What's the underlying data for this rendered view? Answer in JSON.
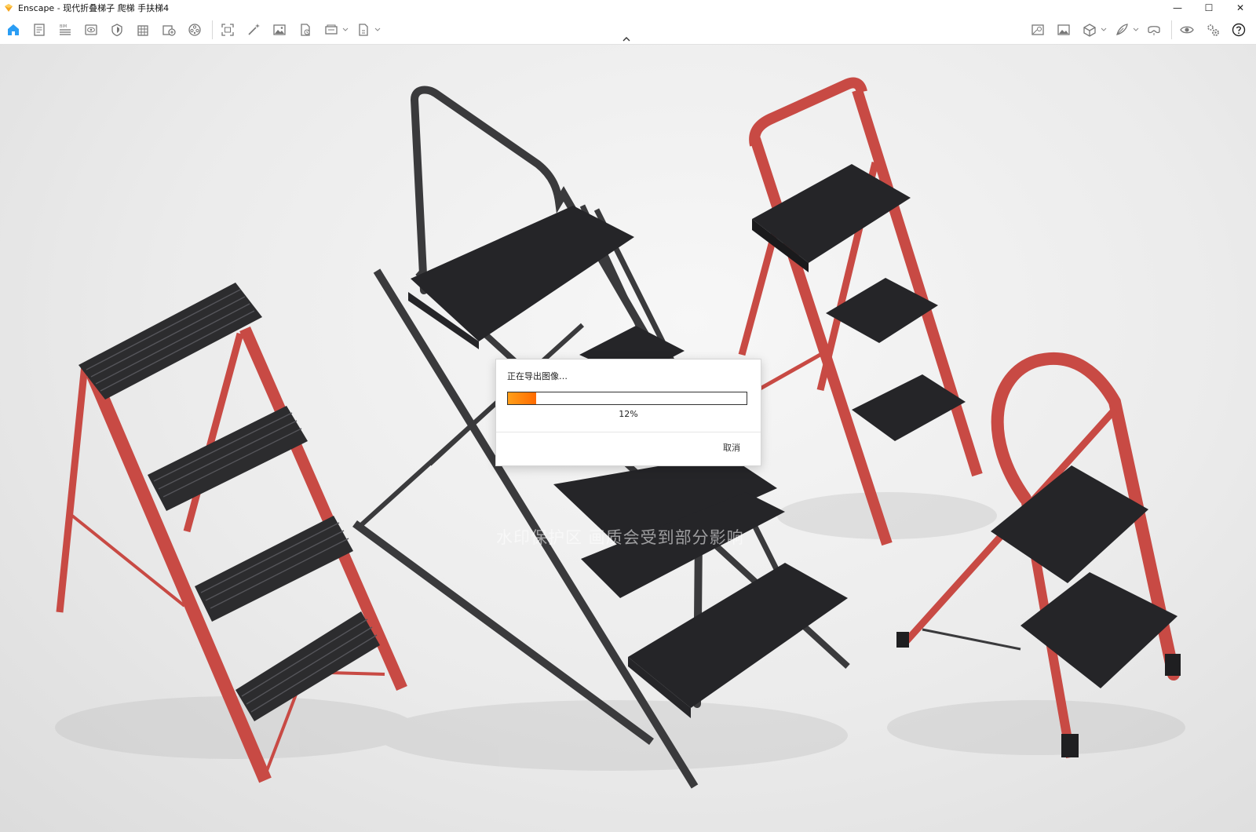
{
  "window": {
    "title": "Enscape - 现代折叠梯子 爬梯 手扶梯4",
    "minimize_glyph": "—",
    "maximize_glyph": "☐",
    "close_glyph": "✕"
  },
  "colors": {
    "accent": "#2a9df4",
    "progress": "#ff7a00",
    "ladder_red": "#c84a44",
    "ladder_black": "#2a2a2c"
  },
  "toolbar": {
    "left_icons": [
      "home-icon",
      "document-icon",
      "bim-icon",
      "visibility-icon",
      "materials-icon",
      "building-icon",
      "export-icon",
      "asset-library-icon",
      "screenshot-icon",
      "magic-wand-icon",
      "image-icon",
      "file-icon",
      "batch-icon",
      "file-export-icon"
    ],
    "right_icons": [
      "map-icon",
      "gallery-icon",
      "cube-icon",
      "feather-icon",
      "vr-icon",
      "eye-icon",
      "settings-icon",
      "help-icon"
    ]
  },
  "viewport": {
    "watermark": "水印保护区  画质会受到部分影响"
  },
  "dialog": {
    "title": "正在导出图像…",
    "progress_percent": 12,
    "progress_label": "12%",
    "cancel_label": "取消"
  }
}
